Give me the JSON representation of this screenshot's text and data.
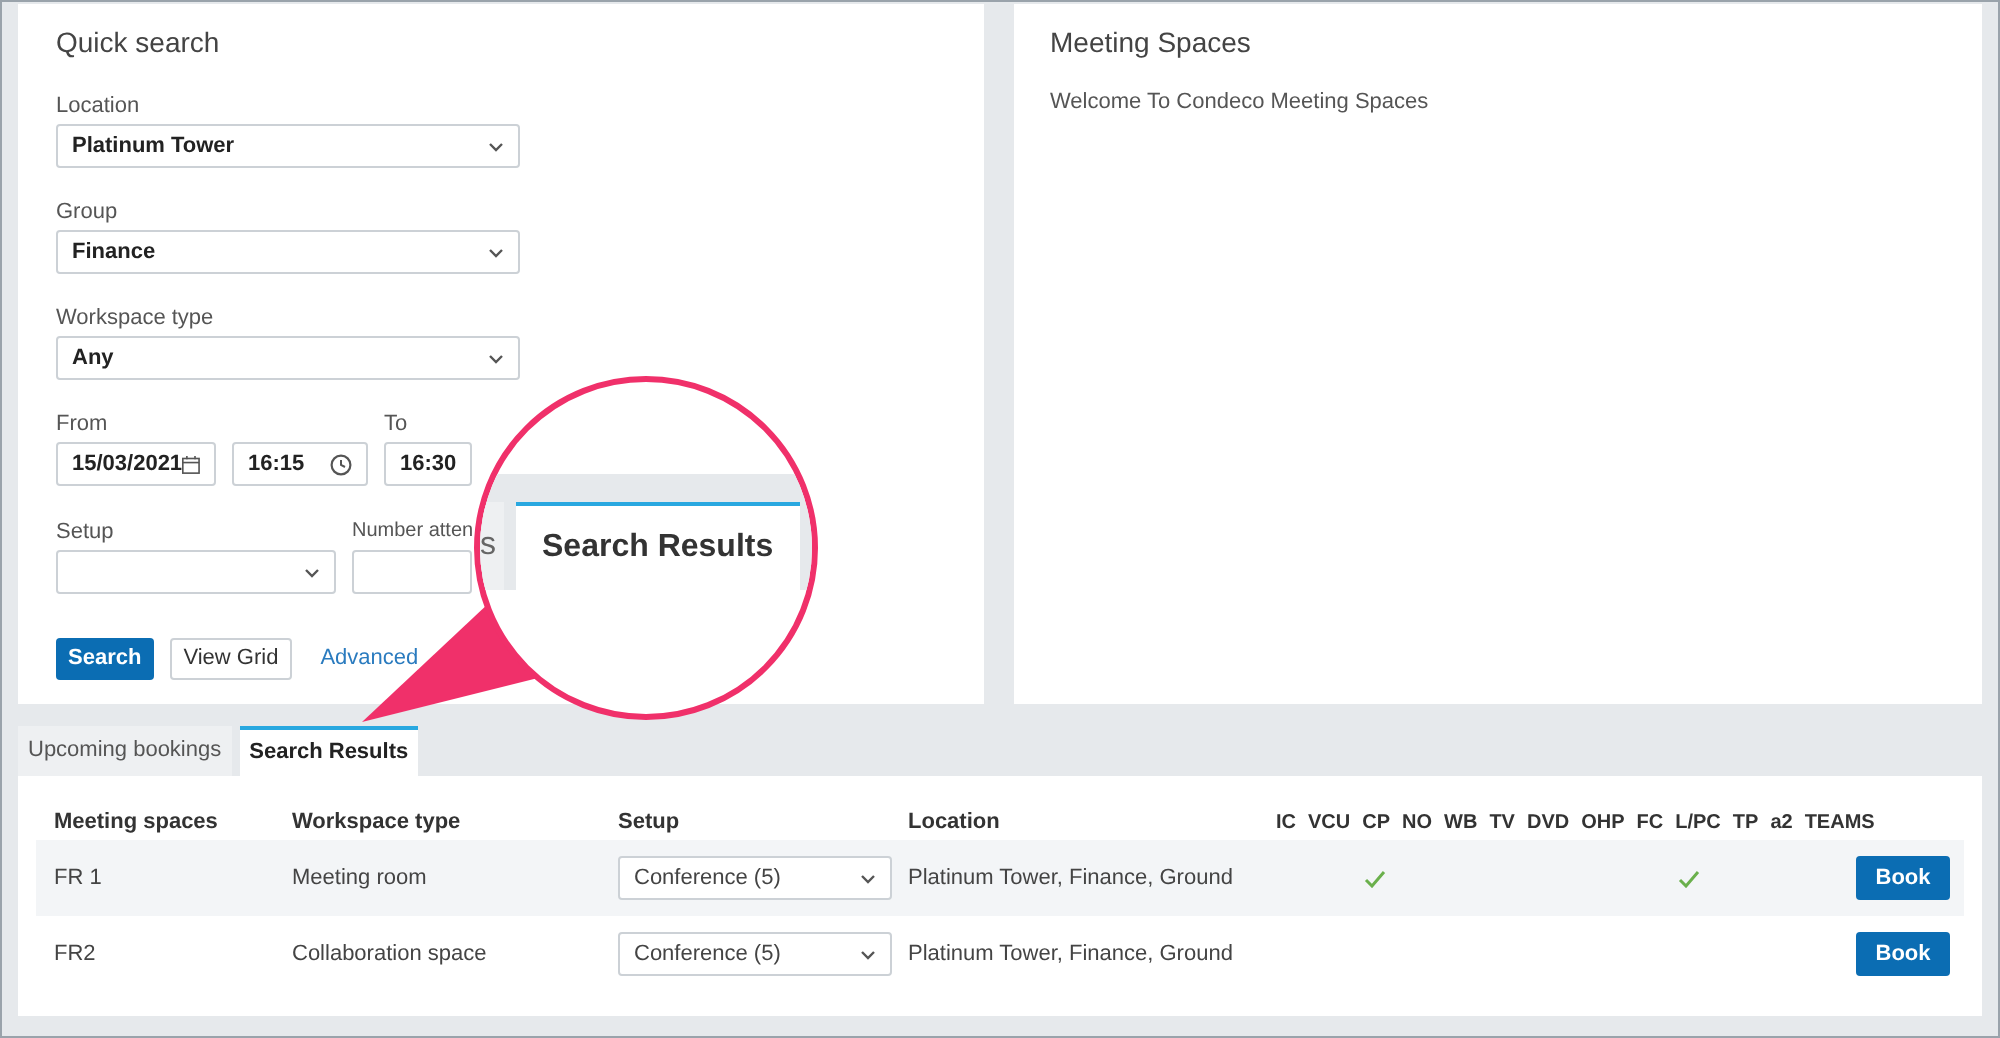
{
  "quick_search": {
    "title": "Quick search",
    "selects": [
      {
        "label": "Location",
        "value": "Platinum Tower"
      },
      {
        "label": "Group",
        "value": "Finance"
      },
      {
        "label": "Workspace type",
        "value": "Any"
      }
    ],
    "from": {
      "label": "From",
      "date": "15/03/2021",
      "time": "16:15"
    },
    "to": {
      "label": "To",
      "time": "16:30"
    },
    "setup": {
      "label": "Setup"
    },
    "attendees": {
      "label": "Number atten"
    },
    "buttons": [
      {
        "label": "Search",
        "kind": "primary"
      },
      {
        "label": "View Grid",
        "kind": "secondary"
      },
      {
        "label": "Advanced",
        "kind": "link"
      }
    ]
  },
  "meeting_spaces": {
    "title": "Meeting Spaces",
    "text": "Welcome To Condeco Meeting Spaces"
  },
  "tabs": [
    {
      "label": "Upcoming bookings",
      "selected": false
    },
    {
      "label": "Search Results",
      "selected": true
    }
  ],
  "table": {
    "columns": [
      "Meeting spaces",
      "Workspace type",
      "Setup",
      "Location"
    ],
    "feature_columns": [
      {
        "label": "IC",
        "ticks": [
          false,
          false
        ]
      },
      {
        "label": "VCU",
        "ticks": [
          false,
          false
        ]
      },
      {
        "label": "CP",
        "ticks": [
          true,
          false
        ]
      },
      {
        "label": "NO",
        "ticks": [
          false,
          false
        ]
      },
      {
        "label": "WB",
        "ticks": [
          false,
          false
        ]
      },
      {
        "label": "TV",
        "ticks": [
          false,
          false
        ]
      },
      {
        "label": "DVD",
        "ticks": [
          false,
          false
        ]
      },
      {
        "label": "OHP",
        "ticks": [
          false,
          false
        ]
      },
      {
        "label": "FC",
        "ticks": [
          false,
          false
        ]
      },
      {
        "label": "L/PC",
        "ticks": [
          true,
          false
        ]
      },
      {
        "label": "TP",
        "ticks": [
          false,
          false
        ]
      },
      {
        "label": "a2",
        "ticks": [
          false,
          false
        ]
      },
      {
        "label": "TEAMS",
        "ticks": [
          false,
          false
        ]
      }
    ],
    "rows": [
      {
        "name": "FR 1",
        "type": "Meeting room",
        "setup": "Conference (5)",
        "location": "Platinum Tower, Finance, Ground",
        "highlighted": true,
        "action": "Book"
      },
      {
        "name": "FR2",
        "type": "Collaboration space",
        "setup": "Conference (5)",
        "location": "Platinum Tower, Finance, Ground",
        "highlighted": false,
        "action": "Book"
      }
    ]
  },
  "magnifier": {
    "tabs": [
      {
        "label": "s",
        "selected": false
      },
      {
        "label": "Search Results",
        "selected": true
      }
    ]
  }
}
